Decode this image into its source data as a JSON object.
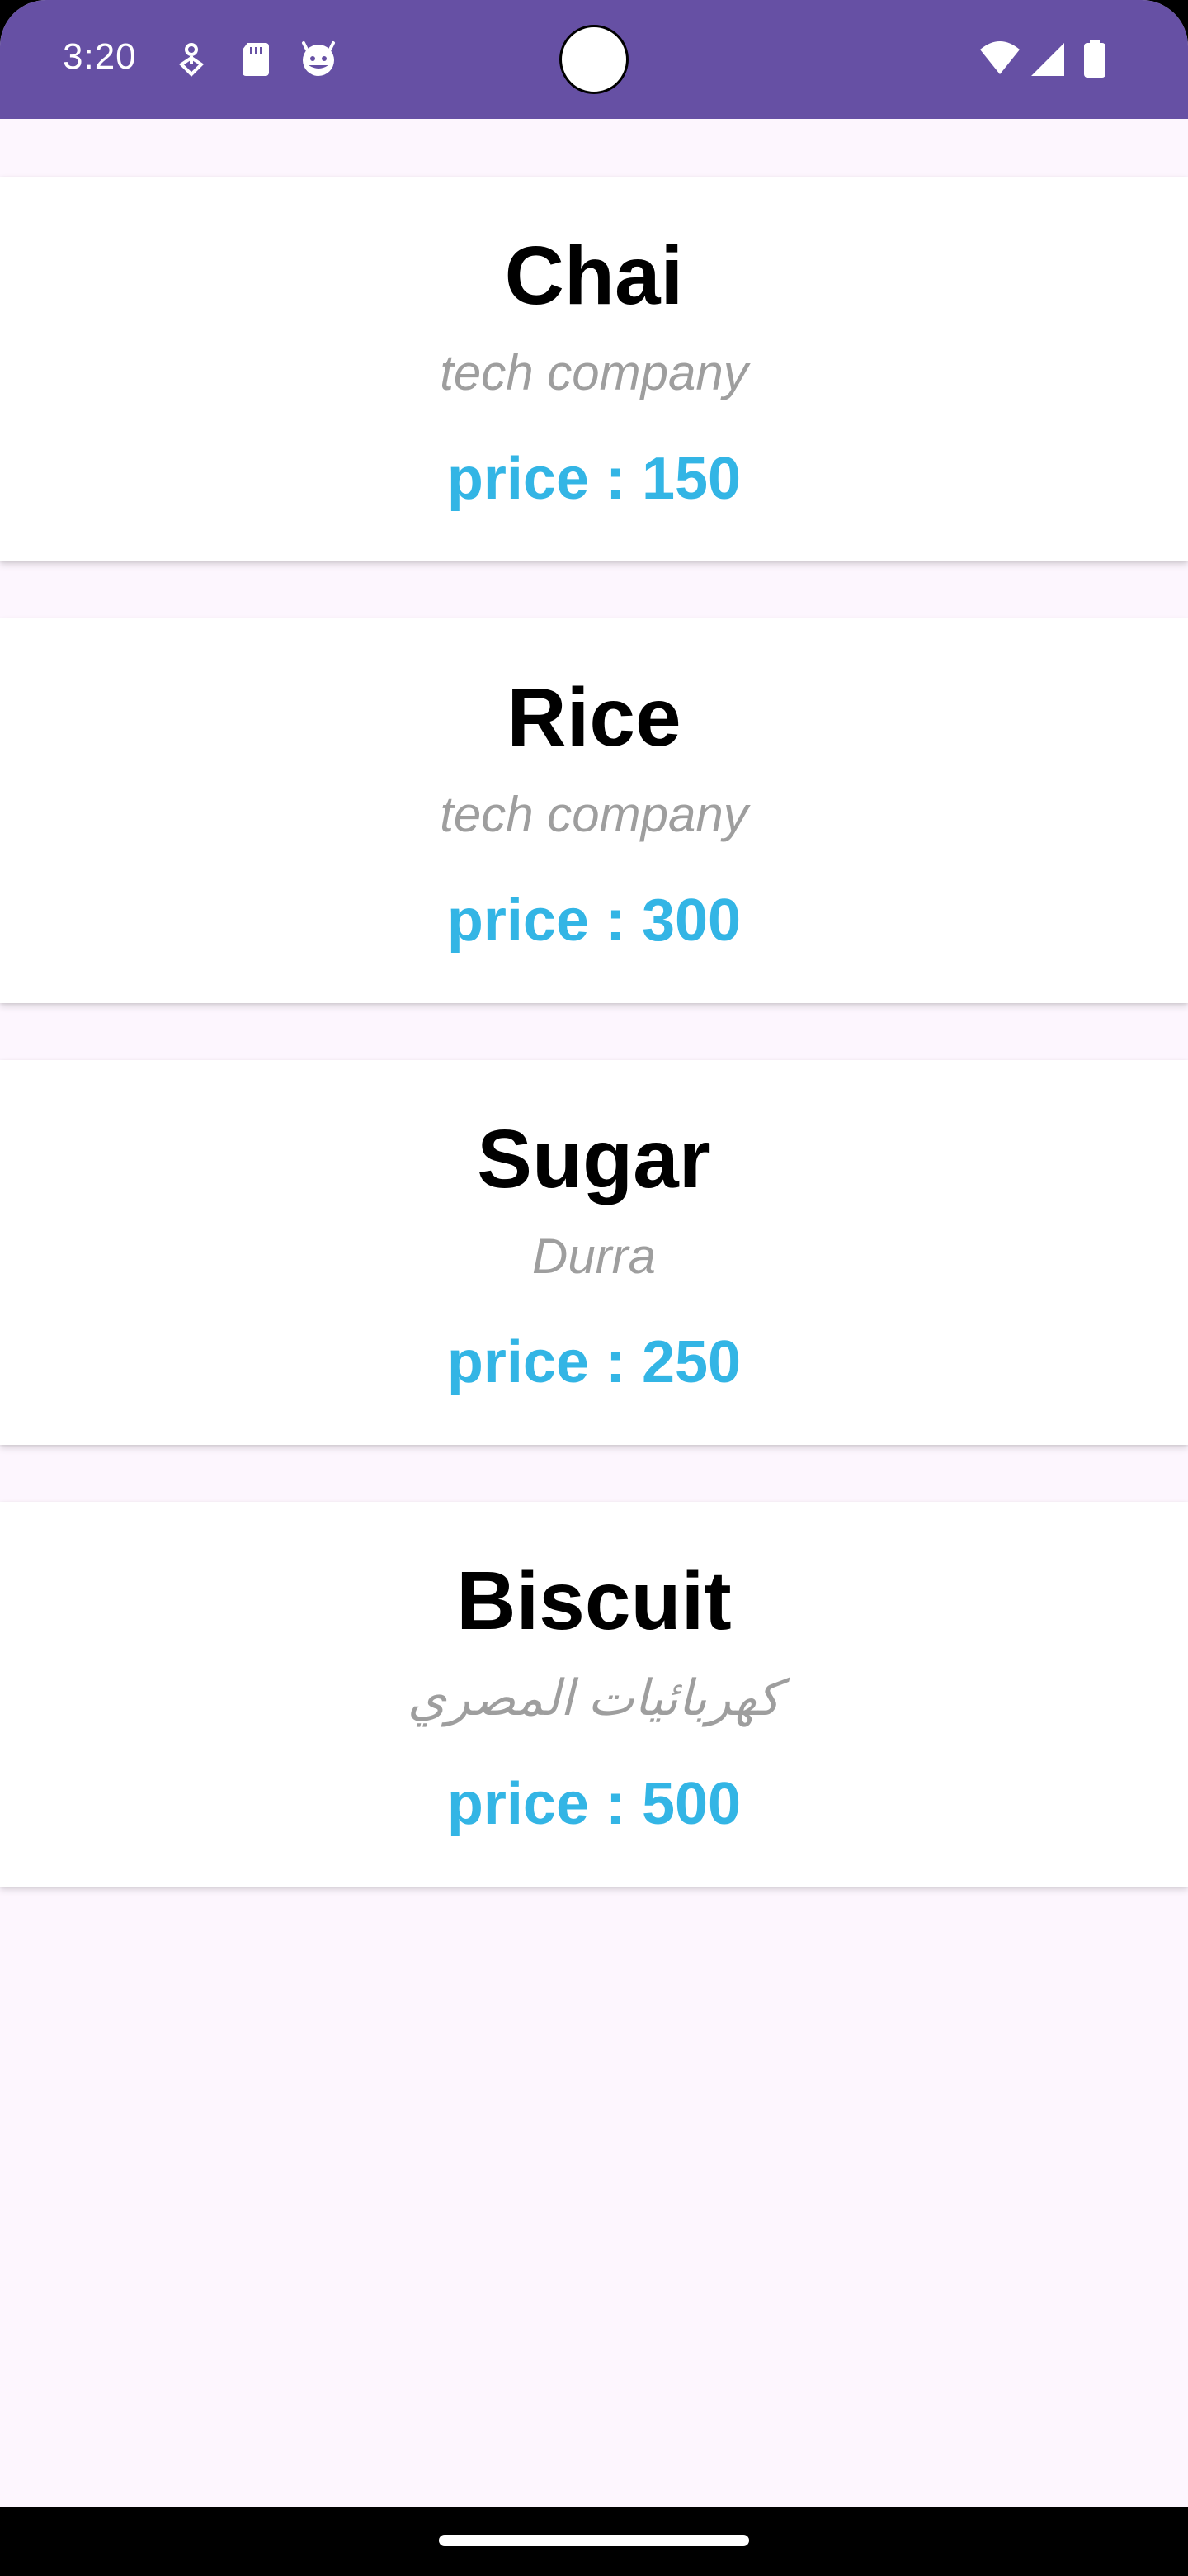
{
  "status_bar": {
    "time": "3:20",
    "left_icons": [
      "location-pin-icon",
      "sd-card-icon",
      "android-face-icon"
    ],
    "right_icons": [
      "wifi-icon",
      "signal-icon",
      "battery-icon"
    ],
    "background_color": "#6650a4"
  },
  "products": [
    {
      "name": "Chai",
      "company": "tech company",
      "price": "price : 150"
    },
    {
      "name": "Rice",
      "company": "tech company",
      "price": "price : 300"
    },
    {
      "name": "Sugar",
      "company": "Durra",
      "price": "price : 250"
    },
    {
      "name": "Biscuit",
      "company": "كهربائيات المصري",
      "price": "price : 500"
    }
  ],
  "colors": {
    "screen_background": "#fdf6fe",
    "price_text": "#33b5e5",
    "subtitle_text": "#9e9e9e"
  }
}
